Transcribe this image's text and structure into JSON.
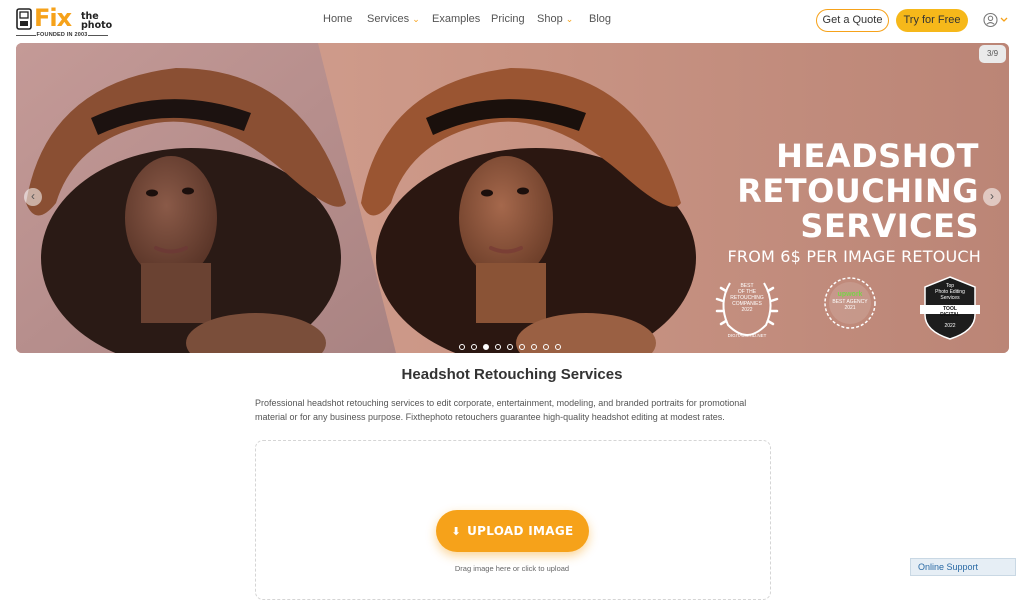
{
  "brand": {
    "fix": "Fix",
    "the": "the",
    "photo": "photo",
    "founded": "FOUNDED IN 2003"
  },
  "nav": {
    "home": "Home",
    "services": "Services",
    "examples": "Examples",
    "pricing": "Pricing",
    "shop": "Shop",
    "blog": "Blog"
  },
  "header": {
    "quote_label": "Get a Quote",
    "try_label": "Try for Free"
  },
  "hero": {
    "counter": "3/9",
    "headline": [
      "HEADSHOT",
      "RETOUCHING",
      "SERVICES"
    ],
    "subline": "FROM 6$ PER IMAGE RETOUCH",
    "slides_total": 9,
    "active_slide": 3,
    "badges": {
      "b1": [
        "BEST",
        "OF THE",
        "RETOUCHING",
        "COMPANIES",
        "2022"
      ],
      "b1_foot": "DIGITALGRID.NET",
      "b2": [
        "upwork",
        "BEST AGENCY",
        "2021"
      ],
      "b3": [
        "Top",
        "Photo Editing",
        "Services",
        "TOOL",
        "DIGITAL",
        "2022"
      ]
    }
  },
  "content": {
    "title": "Headshot Retouching Services",
    "description": "Professional headshot retouching services to edit corporate, entertainment, modeling, and branded portraits for promotional material or for any business purpose. Fixthephoto retouchers guarantee high-quality headshot editing at modest rates."
  },
  "upload": {
    "button_label": "UPLOAD IMAGE",
    "hint": "Drag image here or click to upload"
  },
  "support": {
    "label": "Online Support"
  },
  "colors": {
    "accent": "#f6a21a",
    "hero_bg": "#c69484"
  }
}
